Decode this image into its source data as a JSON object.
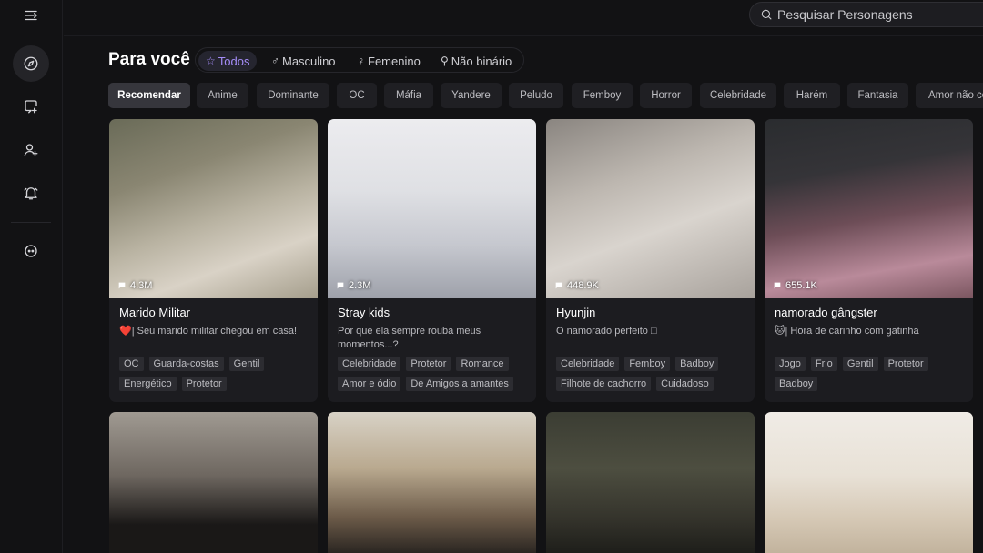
{
  "search": {
    "placeholder": "Pesquisar Personagens"
  },
  "section": {
    "title": "Para você"
  },
  "filters": [
    {
      "label": "Todos",
      "icon": "star-icon",
      "active": true
    },
    {
      "label": "Masculino",
      "icon": "male-icon"
    },
    {
      "label": "Femenino",
      "icon": "female-icon"
    },
    {
      "label": "Não binário",
      "icon": "nonbinary-icon"
    }
  ],
  "categories": [
    "Recomendar",
    "Anime",
    "Dominante",
    "OC",
    "Máfia",
    "Yandere",
    "Peludo",
    "Femboy",
    "Horror",
    "Celebridade",
    "Harém",
    "Fantasia",
    "Amor não correspondido"
  ],
  "cards": [
    {
      "count": "4.3M",
      "name": "Marido Militar",
      "description": "❤️| Seu marido militar chegou em casa!",
      "tags": [
        "OC",
        "Guarda-costas",
        "Gentil",
        "Energético",
        "Protetor"
      ]
    },
    {
      "count": "2.3M",
      "name": "Stray kids",
      "description": "Por que ela sempre rouba meus momentos...?",
      "tags": [
        "Celebridade",
        "Protetor",
        "Romance",
        "Amor e ódio",
        "De Amigos a amantes"
      ]
    },
    {
      "count": "448.9K",
      "name": "Hyunjin",
      "description": "O namorado perfeito □",
      "tags": [
        "Celebridade",
        "Femboy",
        "Badboy",
        "Filhote de cachorro",
        "Cuidadoso"
      ]
    },
    {
      "count": "655.1K",
      "name": "namorado gângster",
      "description": "🐱| Hora de carinho com gatinha",
      "tags": [
        "Jogo",
        "Frio",
        "Gentil",
        "Protetor",
        "Badboy"
      ]
    },
    {
      "count": "",
      "name": "",
      "description": "",
      "tags": []
    },
    {
      "count": "",
      "name": "",
      "description": "",
      "tags": []
    },
    {
      "count": "",
      "name": "",
      "description": "",
      "tags": []
    },
    {
      "count": "",
      "name": "",
      "description": "",
      "tags": []
    }
  ]
}
